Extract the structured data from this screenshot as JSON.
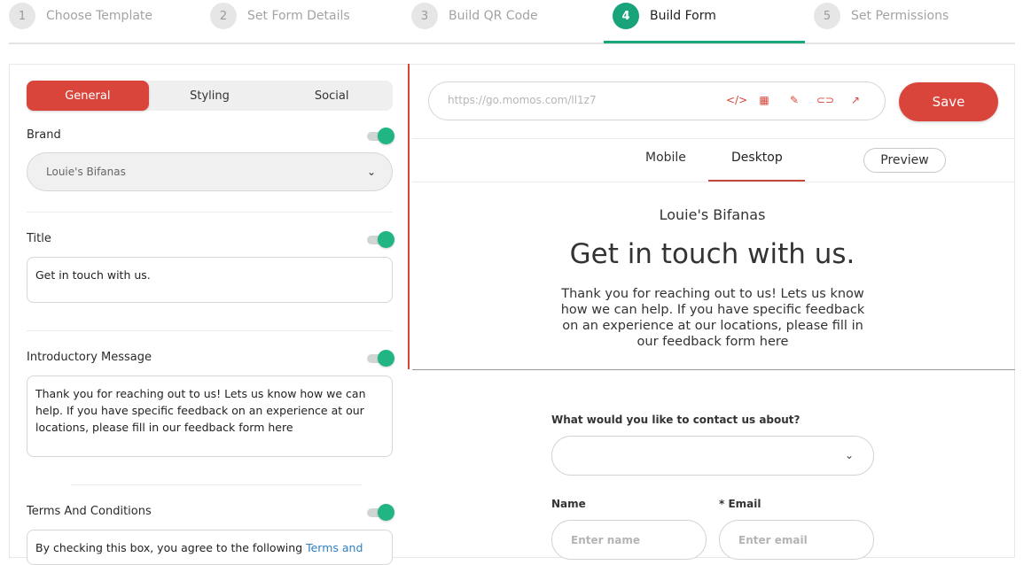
{
  "stepper": {
    "steps": [
      {
        "num": "1",
        "label": "Choose Template"
      },
      {
        "num": "2",
        "label": "Set Form Details"
      },
      {
        "num": "3",
        "label": "Build QR Code"
      },
      {
        "num": "4",
        "label": "Build Form",
        "active": true
      },
      {
        "num": "5",
        "label": "Set Permissions"
      }
    ]
  },
  "left": {
    "tabs": [
      {
        "label": "General",
        "active": true
      },
      {
        "label": "Styling"
      },
      {
        "label": "Social"
      }
    ],
    "brand": {
      "label": "Brand",
      "toggle_on": true,
      "value": "Louie's Bifanas"
    },
    "title": {
      "label": "Title",
      "toggle_on": true,
      "value": "Get in touch with us."
    },
    "intro": {
      "label": "Introductory Message",
      "toggle_on": true,
      "value": "Thank you for reaching out to us! Lets us know how we can help. If you have specific feedback on an experience at our locations, please fill in our feedback form here"
    },
    "terms": {
      "label": "Terms And Conditions",
      "toggle_on": true,
      "value": "By checking this box, you agree to the following ",
      "link": "Terms and"
    }
  },
  "right": {
    "url": "https://go.momos.com/ll1z7",
    "url_icons": [
      "code-icon",
      "qr-icon",
      "pencil-icon",
      "link-icon",
      "external-link-icon"
    ],
    "url_icon_glyphs": [
      "</>",
      "▦",
      "✎",
      "⊂⊃",
      "↗"
    ],
    "save_label": "Save",
    "view_tabs": [
      {
        "label": "Mobile"
      },
      {
        "label": "Desktop",
        "active": true
      }
    ],
    "preview_label": "Preview",
    "preview": {
      "brand": "Louie's Bifanas",
      "title": "Get in touch with us.",
      "message": "Thank you for reaching out to us! Lets us know how we can help. If you have specific feedback on an experience at our locations, please fill in our feedback form here",
      "question_label": "What would you like to contact us about?",
      "name_label": "Name",
      "email_label": "* Email",
      "name_placeholder": "Enter name",
      "email_placeholder": "Enter email"
    }
  },
  "colors": {
    "accent_red": "#d9453a",
    "accent_green": "#1aa67d"
  }
}
